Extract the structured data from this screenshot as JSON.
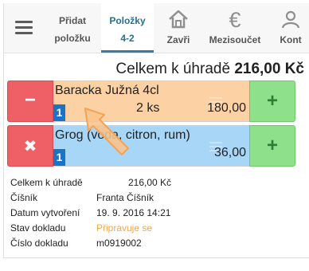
{
  "toolbar": {
    "menu_icon": "hamburger-menu-icon",
    "add_item": {
      "line1": "Přidat",
      "line2": "položku"
    },
    "items_tab": {
      "line1": "Položky",
      "line2": "4-2"
    },
    "close": {
      "icon": "house-icon",
      "label": "Zavři"
    },
    "subtotal": {
      "icon": "euro-icon",
      "glyph": "€",
      "label": "Mezisoučet"
    },
    "contact": {
      "icon": "person-icon",
      "label": "Kont"
    }
  },
  "summary": {
    "label": "Celkem k úhradě",
    "amount": "216,00 Kč"
  },
  "items": [
    {
      "name": "Baracka Južná 4cl",
      "badge": "1",
      "qty": "2 ks",
      "price": "180,00",
      "left_action": "minus-icon",
      "left_glyph": "−",
      "right_action": "plus-icon",
      "right_glyph": "+",
      "color": "#fcd1a3"
    },
    {
      "name": "Grog (voda, citron, rum)",
      "badge": "1",
      "qty": "",
      "price": "36,00",
      "left_action": "delete-x-icon",
      "left_glyph": "✖",
      "right_action": "plus-icon",
      "right_glyph": "+",
      "color": "#a7d6f6"
    }
  ],
  "details": [
    {
      "label": "Celkem k úhradě",
      "value": "216,00 Kč"
    },
    {
      "label": "Číšník",
      "value": "Franta Číšník"
    },
    {
      "label": "Datum vytvoření",
      "value": "19. 9. 2016 14:21"
    },
    {
      "label": "Stav dokladu",
      "value": "Připravuje se"
    },
    {
      "label": "Číslo dokladu",
      "value": "m0919002"
    }
  ],
  "colors": {
    "minus_button": "#ef5f66",
    "plus_button": "#8ee08b",
    "active_tab": "#2a6f8f",
    "status_text": "#f0a94d",
    "badge": "#1a73c4"
  }
}
